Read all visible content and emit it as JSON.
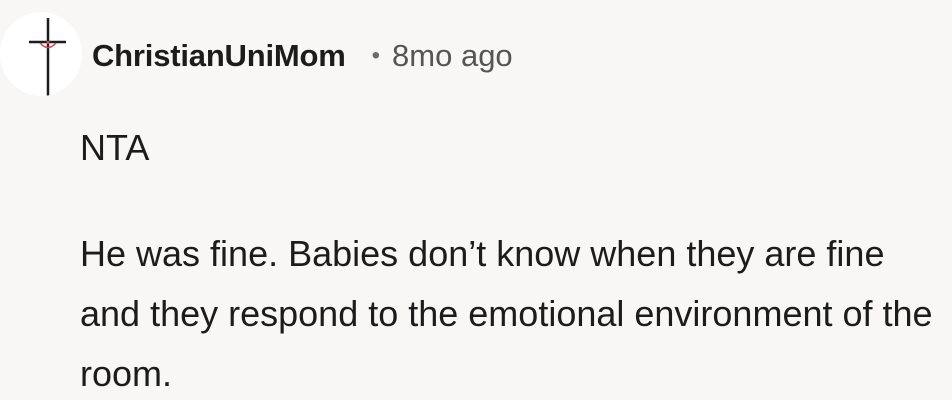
{
  "comment": {
    "author": "ChristianUniMom",
    "separator": "•",
    "age": "8mo ago",
    "avatar_icon": "cross-icon",
    "paragraphs": [
      "NTA",
      "He was fine. Babies don’t know when they are fine and they respond to the emotional environment of the room."
    ]
  },
  "colors": {
    "background": "#f8f7f6",
    "text": "#1c1c1c",
    "meta": "#555555",
    "cross_accent": "#c9485b"
  }
}
